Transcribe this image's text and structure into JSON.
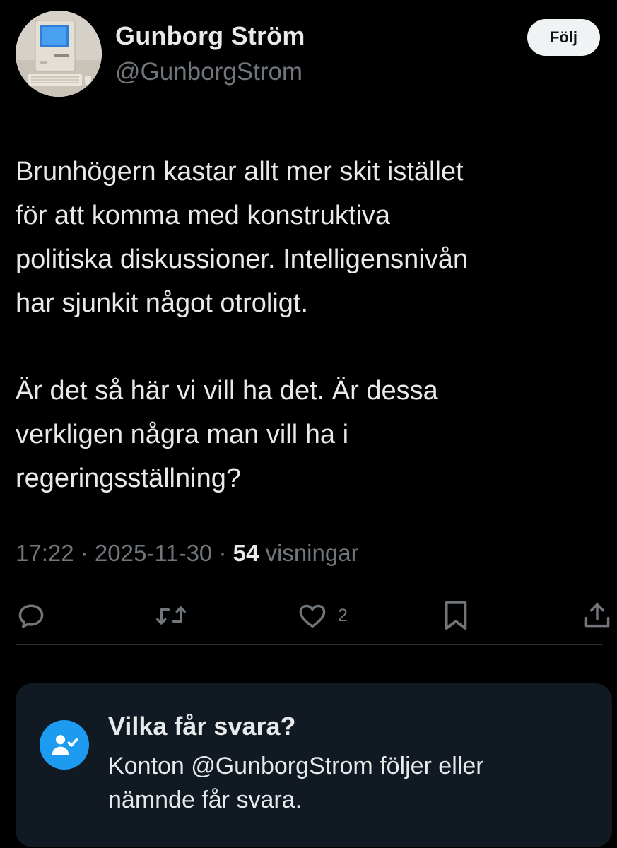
{
  "author": {
    "display_name": "Gunborg Ström",
    "handle": "@GunborgStrom",
    "avatar_subject": "vintage-computer-photo"
  },
  "follow_button": {
    "label": "Följ"
  },
  "tweet": {
    "paragraphs": [
      "Brunhögern kastar allt mer skit istället\nför att komma med konstruktiva\npolitiska diskussioner. Intelligensnivån\nhar sjunkit något otroligt.",
      "Är det så här vi vill ha det. Är dessa\nverkligen några man vill ha i\nregeringsställning?"
    ]
  },
  "meta": {
    "time": "17:22",
    "separator": " · ",
    "date": "2025-11-30",
    "views_count": "54",
    "views_label": " visningar"
  },
  "actions": {
    "reply_icon": "reply-icon",
    "retweet_icon": "retweet-icon",
    "like_icon": "heart-icon",
    "like_count": "2",
    "bookmark_icon": "bookmark-icon",
    "share_icon": "share-icon"
  },
  "reply_restriction": {
    "title": "Vilka får svara?",
    "description": "Konton @GunborgStrom följer eller nämnde får svara."
  },
  "colors": {
    "background": "#000000",
    "text_primary": "#e7e9ea",
    "text_secondary": "#71767b",
    "accent_blue": "#1d9bf0",
    "card_background": "#111923",
    "divider": "#2f3336",
    "button_background": "#eff3f4"
  }
}
